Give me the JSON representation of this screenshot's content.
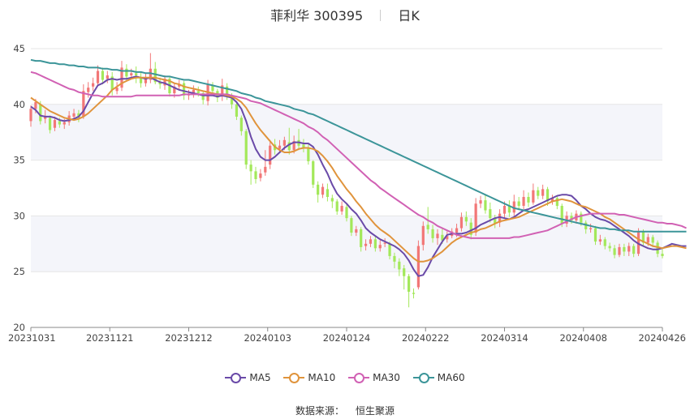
{
  "header": {
    "title": "菲利华 300395",
    "period": "日K"
  },
  "footer": {
    "source_label": "数据来源：",
    "source_name": "恒生聚源"
  },
  "colors": {
    "up": "#f27777",
    "down": "#a3e85a",
    "MA5": "#6a4aa8",
    "MA10": "#e0943c",
    "MA30": "#d161b4",
    "MA60": "#3c9599",
    "band": "#f4f5fa",
    "grid": "#e6e6e6"
  },
  "chart_data": {
    "type": "candlestick",
    "title": "菲利华 300395",
    "ylim": [
      20,
      45
    ],
    "yticks": [
      "20",
      "25",
      "30",
      "35",
      "40",
      "45"
    ],
    "xticks": [
      "20231031",
      "20231121",
      "20231212",
      "20240103",
      "20240124",
      "20240222",
      "20240314",
      "20240408",
      "20240426"
    ],
    "legend": [
      "MA5",
      "MA10",
      "MA30",
      "MA60"
    ],
    "legend_position": "bottom",
    "candles": [
      [
        38.5,
        39.6,
        39.9,
        38.0
      ],
      [
        39.6,
        40.2,
        40.5,
        39.2
      ],
      [
        40.0,
        38.5,
        40.3,
        38.2
      ],
      [
        38.7,
        38.9,
        39.5,
        38.3
      ],
      [
        38.8,
        37.7,
        39.0,
        37.4
      ],
      [
        37.9,
        38.6,
        38.9,
        37.6
      ],
      [
        38.5,
        38.2,
        38.8,
        37.9
      ],
      [
        38.2,
        38.4,
        38.7,
        37.8
      ],
      [
        38.4,
        39.0,
        39.4,
        38.1
      ],
      [
        38.9,
        39.2,
        39.6,
        38.6
      ],
      [
        39.2,
        38.8,
        39.5,
        38.4
      ],
      [
        38.9,
        41.2,
        41.8,
        38.7
      ],
      [
        41.1,
        41.5,
        42.0,
        40.6
      ],
      [
        41.6,
        41.9,
        42.4,
        41.2
      ],
      [
        41.9,
        43.0,
        43.5,
        41.6
      ],
      [
        43.0,
        42.2,
        43.3,
        41.8
      ],
      [
        42.3,
        42.6,
        43.0,
        41.9
      ],
      [
        42.5,
        41.3,
        42.9,
        40.8
      ],
      [
        41.2,
        41.5,
        42.0,
        40.9
      ],
      [
        41.5,
        43.3,
        43.9,
        41.2
      ],
      [
        43.2,
        42.5,
        43.6,
        42.1
      ],
      [
        42.6,
        42.8,
        43.2,
        42.3
      ],
      [
        42.8,
        42.6,
        43.4,
        41.9
      ],
      [
        42.4,
        41.9,
        42.9,
        41.5
      ],
      [
        41.9,
        42.3,
        42.8,
        41.6
      ],
      [
        42.2,
        43.2,
        44.6,
        41.9
      ],
      [
        43.2,
        42.0,
        43.8,
        41.8
      ],
      [
        42.0,
        41.8,
        42.4,
        41.4
      ],
      [
        41.7,
        42.3,
        42.6,
        41.3
      ],
      [
        42.3,
        41.0,
        42.5,
        40.7
      ],
      [
        41.0,
        41.6,
        41.9,
        40.6
      ],
      [
        41.6,
        41.8,
        42.2,
        41.3
      ],
      [
        41.9,
        40.8,
        42.1,
        40.4
      ],
      [
        40.8,
        40.9,
        41.3,
        40.4
      ],
      [
        40.9,
        41.3,
        41.7,
        40.6
      ],
      [
        41.2,
        41.0,
        41.6,
        40.7
      ],
      [
        41.0,
        40.4,
        41.2,
        40.0
      ],
      [
        40.3,
        41.8,
        42.2,
        39.9
      ],
      [
        41.7,
        41.2,
        42.0,
        40.8
      ],
      [
        41.2,
        40.6,
        41.4,
        40.2
      ],
      [
        40.7,
        41.7,
        42.3,
        40.3
      ],
      [
        41.6,
        40.8,
        41.9,
        40.4
      ],
      [
        40.8,
        40.0,
        41.0,
        39.6
      ],
      [
        40.0,
        38.9,
        40.2,
        38.6
      ],
      [
        38.8,
        37.6,
        39.0,
        37.2
      ],
      [
        37.6,
        34.6,
        37.8,
        34.2
      ],
      [
        34.6,
        34.0,
        35.0,
        32.8
      ],
      [
        34.0,
        33.3,
        34.4,
        32.9
      ],
      [
        33.4,
        33.8,
        34.2,
        33.1
      ],
      [
        33.9,
        34.4,
        35.9,
        33.6
      ],
      [
        34.6,
        36.3,
        36.8,
        34.2
      ],
      [
        36.4,
        35.9,
        36.9,
        35.5
      ],
      [
        36.0,
        36.3,
        36.8,
        35.7
      ],
      [
        36.3,
        36.8,
        37.1,
        35.9
      ],
      [
        36.6,
        35.9,
        37.9,
        35.5
      ],
      [
        35.9,
        36.7,
        37.2,
        35.6
      ],
      [
        36.8,
        36.3,
        37.8,
        35.9
      ],
      [
        36.4,
        36.1,
        36.9,
        35.7
      ],
      [
        36.1,
        34.9,
        36.4,
        34.6
      ],
      [
        34.9,
        32.8,
        35.0,
        32.5
      ],
      [
        32.8,
        31.9,
        33.1,
        31.2
      ],
      [
        31.9,
        32.6,
        32.9,
        31.6
      ],
      [
        32.4,
        31.7,
        32.9,
        31.3
      ],
      [
        31.6,
        31.3,
        31.9,
        30.7
      ],
      [
        31.3,
        30.4,
        31.5,
        30.1
      ],
      [
        30.4,
        30.9,
        31.3,
        30.1
      ],
      [
        30.8,
        29.8,
        31.0,
        29.5
      ],
      [
        29.8,
        28.5,
        30.0,
        28.2
      ],
      [
        28.5,
        28.8,
        29.1,
        28.2
      ],
      [
        28.8,
        27.2,
        29.0,
        26.8
      ],
      [
        27.3,
        27.5,
        27.9,
        26.9
      ],
      [
        27.5,
        27.9,
        28.2,
        27.2
      ],
      [
        27.9,
        27.1,
        28.2,
        26.8
      ],
      [
        27.1,
        27.4,
        27.8,
        26.8
      ],
      [
        27.5,
        27.6,
        28.0,
        27.2
      ],
      [
        27.5,
        26.4,
        27.7,
        26.1
      ],
      [
        26.4,
        25.9,
        26.7,
        25.3
      ],
      [
        25.9,
        25.2,
        26.2,
        24.6
      ],
      [
        25.3,
        24.6,
        25.6,
        23.4
      ],
      [
        24.6,
        23.2,
        24.8,
        21.8
      ],
      [
        23.1,
        23.0,
        23.5,
        22.6
      ],
      [
        23.6,
        27.3,
        27.8,
        23.4
      ],
      [
        27.4,
        29.1,
        29.5,
        26.9
      ],
      [
        29.2,
        28.8,
        30.8,
        28.4
      ],
      [
        28.8,
        28.0,
        29.2,
        27.6
      ],
      [
        28.0,
        28.4,
        28.8,
        27.4
      ],
      [
        28.3,
        27.8,
        28.9,
        27.5
      ],
      [
        27.9,
        28.2,
        28.6,
        27.6
      ],
      [
        28.2,
        28.6,
        28.9,
        28.0
      ],
      [
        28.5,
        28.9,
        29.3,
        28.1
      ],
      [
        28.9,
        29.9,
        30.3,
        28.6
      ],
      [
        29.9,
        29.5,
        30.4,
        29.1
      ],
      [
        29.4,
        28.3,
        29.8,
        27.9
      ],
      [
        28.5,
        31.1,
        31.6,
        28.2
      ],
      [
        31.1,
        31.4,
        31.8,
        30.7
      ],
      [
        31.4,
        30.5,
        31.9,
        30.2
      ],
      [
        30.6,
        29.8,
        31.2,
        29.4
      ],
      [
        29.8,
        29.3,
        30.1,
        28.9
      ],
      [
        29.4,
        30.2,
        30.6,
        29.0
      ],
      [
        30.2,
        30.9,
        31.3,
        29.8
      ],
      [
        30.9,
        30.3,
        31.4,
        29.9
      ],
      [
        30.3,
        31.3,
        31.9,
        30.0
      ],
      [
        31.3,
        30.9,
        31.7,
        30.5
      ],
      [
        30.9,
        31.7,
        32.3,
        30.6
      ],
      [
        31.7,
        31.2,
        32.1,
        30.8
      ],
      [
        31.2,
        32.3,
        32.9,
        31.0
      ],
      [
        32.3,
        31.8,
        32.6,
        31.5
      ],
      [
        31.8,
        32.4,
        32.8,
        31.5
      ],
      [
        32.4,
        31.3,
        32.6,
        30.9
      ],
      [
        31.3,
        31.6,
        31.9,
        31.0
      ],
      [
        31.6,
        30.9,
        31.8,
        30.6
      ],
      [
        30.9,
        29.3,
        31.1,
        29.0
      ],
      [
        29.3,
        30.0,
        30.4,
        29.0
      ],
      [
        30.0,
        29.6,
        30.3,
        29.3
      ],
      [
        29.6,
        30.2,
        30.5,
        29.3
      ],
      [
        30.2,
        29.4,
        30.4,
        29.1
      ],
      [
        29.4,
        28.8,
        29.6,
        28.4
      ],
      [
        28.8,
        28.9,
        29.3,
        28.5
      ],
      [
        28.9,
        27.7,
        29.1,
        27.4
      ],
      [
        27.7,
        27.9,
        28.3,
        27.4
      ],
      [
        27.9,
        27.3,
        28.1,
        27.0
      ],
      [
        27.3,
        27.1,
        27.6,
        26.8
      ],
      [
        27.1,
        26.5,
        27.4,
        26.2
      ],
      [
        26.5,
        27.2,
        27.5,
        26.3
      ],
      [
        27.2,
        26.8,
        27.5,
        26.4
      ],
      [
        26.8,
        27.3,
        27.6,
        26.4
      ],
      [
        27.3,
        26.6,
        27.5,
        26.3
      ],
      [
        26.6,
        28.6,
        28.9,
        26.4
      ],
      [
        28.6,
        27.6,
        28.8,
        27.3
      ],
      [
        27.6,
        28.1,
        28.4,
        27.3
      ],
      [
        28.1,
        27.6,
        28.3,
        27.2
      ],
      [
        27.6,
        26.6,
        27.8,
        26.3
      ],
      [
        26.6,
        26.4,
        27.0,
        26.2
      ]
    ],
    "series": [
      {
        "name": "MA5",
        "values": [
          39.8,
          39.5,
          39.0,
          38.9,
          38.9,
          38.8,
          38.6,
          38.5,
          38.6,
          38.7,
          38.9,
          39.4,
          40.2,
          41.0,
          41.7,
          41.9,
          42.2,
          42.3,
          42.2,
          42.3,
          42.3,
          42.4,
          42.5,
          42.4,
          42.3,
          42.4,
          42.2,
          42.0,
          41.9,
          41.7,
          41.5,
          41.3,
          41.2,
          41.1,
          41.0,
          40.9,
          40.8,
          40.8,
          40.8,
          40.7,
          40.8,
          40.7,
          40.6,
          40.2,
          39.6,
          38.5,
          37.1,
          36.0,
          35.3,
          35.0,
          35.0,
          35.3,
          35.7,
          36.1,
          36.4,
          36.6,
          36.6,
          36.5,
          36.5,
          36.2,
          35.5,
          34.6,
          33.8,
          32.8,
          32.0,
          31.5,
          31.1,
          30.6,
          30.2,
          29.6,
          28.9,
          28.5,
          28.2,
          27.9,
          27.7,
          27.5,
          27.3,
          27.0,
          26.6,
          26.0,
          25.2,
          24.6,
          24.7,
          25.4,
          26.3,
          27.0,
          27.7,
          28.3,
          28.4,
          28.4,
          28.4,
          28.5,
          28.7,
          28.9,
          29.2,
          29.4,
          29.6,
          29.8,
          29.9,
          29.8,
          29.7,
          29.9,
          30.2,
          30.5,
          30.6,
          30.8,
          31.0,
          31.2,
          31.4,
          31.6,
          31.8,
          31.9,
          31.9,
          31.8,
          31.4,
          30.9,
          30.6,
          30.2,
          29.9,
          29.7,
          29.6,
          29.4,
          29.1,
          28.8,
          28.5,
          28.2,
          27.8,
          27.5,
          27.3,
          27.1,
          27.0,
          27.0,
          27.1,
          27.3,
          27.5,
          27.4,
          27.3,
          27.3
        ]
      },
      {
        "name": "MA10",
        "values": [
          40.6,
          40.3,
          40.0,
          39.7,
          39.4,
          39.2,
          39.0,
          38.8,
          38.7,
          38.6,
          38.7,
          38.9,
          39.2,
          39.6,
          40.0,
          40.4,
          40.8,
          41.3,
          41.6,
          41.9,
          42.1,
          42.3,
          42.4,
          42.4,
          42.4,
          42.4,
          42.4,
          42.3,
          42.2,
          42.1,
          41.9,
          41.8,
          41.6,
          41.5,
          41.4,
          41.3,
          41.2,
          41.1,
          41.0,
          40.9,
          40.9,
          40.8,
          40.7,
          40.5,
          40.2,
          39.7,
          39.0,
          38.3,
          37.7,
          37.2,
          36.7,
          36.2,
          35.9,
          35.7,
          35.7,
          35.8,
          36.0,
          36.1,
          36.1,
          36.0,
          35.8,
          35.4,
          34.9,
          34.3,
          33.6,
          33.0,
          32.4,
          31.9,
          31.3,
          30.8,
          30.2,
          29.7,
          29.2,
          28.8,
          28.5,
          28.2,
          27.8,
          27.4,
          27.0,
          26.6,
          26.2,
          25.9,
          25.9,
          26.0,
          26.2,
          26.5,
          26.8,
          27.2,
          27.6,
          27.9,
          28.1,
          28.3,
          28.5,
          28.6,
          28.8,
          28.9,
          29.1,
          29.3,
          29.5,
          29.6,
          29.7,
          29.8,
          29.9,
          30.1,
          30.3,
          30.5,
          30.7,
          30.9,
          31.1,
          31.3,
          31.4,
          31.5,
          31.4,
          31.3,
          31.1,
          30.9,
          30.8,
          30.6,
          30.4,
          30.2,
          29.9,
          29.7,
          29.4,
          29.1,
          28.8,
          28.5,
          28.2,
          27.9,
          27.7,
          27.5,
          27.3,
          27.2,
          27.1,
          27.2,
          27.3,
          27.3,
          27.2,
          27.1
        ]
      },
      {
        "name": "MA30",
        "values": [
          42.9,
          42.8,
          42.6,
          42.4,
          42.2,
          42.0,
          41.8,
          41.6,
          41.4,
          41.3,
          41.1,
          41.0,
          40.9,
          40.8,
          40.8,
          40.7,
          40.7,
          40.7,
          40.7,
          40.7,
          40.7,
          40.7,
          40.8,
          40.8,
          40.8,
          40.8,
          40.8,
          40.8,
          40.8,
          40.8,
          40.8,
          40.8,
          40.9,
          40.9,
          40.9,
          40.9,
          40.9,
          40.9,
          40.9,
          40.9,
          40.9,
          40.9,
          40.8,
          40.7,
          40.6,
          40.5,
          40.3,
          40.2,
          40.1,
          39.9,
          39.7,
          39.5,
          39.3,
          39.1,
          38.9,
          38.7,
          38.5,
          38.3,
          38.0,
          37.8,
          37.5,
          37.1,
          36.8,
          36.4,
          36.0,
          35.6,
          35.2,
          34.8,
          34.4,
          34.0,
          33.6,
          33.2,
          32.9,
          32.5,
          32.2,
          31.9,
          31.6,
          31.3,
          31.0,
          30.7,
          30.4,
          30.1,
          29.9,
          29.6,
          29.4,
          29.1,
          28.9,
          28.7,
          28.5,
          28.3,
          28.2,
          28.1,
          28.0,
          28.0,
          28.0,
          28.0,
          28.0,
          28.0,
          28.0,
          28.0,
          28.0,
          28.1,
          28.1,
          28.2,
          28.3,
          28.4,
          28.5,
          28.6,
          28.7,
          28.9,
          29.1,
          29.3,
          29.5,
          29.7,
          29.9,
          30.0,
          30.1,
          30.2,
          30.2,
          30.2,
          30.2,
          30.2,
          30.2,
          30.1,
          30.1,
          30.0,
          29.9,
          29.8,
          29.7,
          29.6,
          29.5,
          29.4,
          29.4,
          29.3,
          29.3,
          29.2,
          29.1,
          28.9
        ]
      },
      {
        "name": "MA60",
        "values": [
          44.0,
          43.9,
          43.9,
          43.8,
          43.7,
          43.7,
          43.6,
          43.6,
          43.5,
          43.5,
          43.4,
          43.4,
          43.3,
          43.3,
          43.3,
          43.2,
          43.2,
          43.1,
          43.1,
          43.0,
          43.0,
          43.0,
          42.9,
          42.9,
          42.8,
          42.8,
          42.7,
          42.6,
          42.5,
          42.5,
          42.4,
          42.3,
          42.2,
          42.2,
          42.1,
          42.0,
          41.9,
          41.8,
          41.7,
          41.6,
          41.5,
          41.4,
          41.3,
          41.2,
          41.0,
          40.9,
          40.8,
          40.6,
          40.5,
          40.3,
          40.2,
          40.1,
          40.0,
          39.9,
          39.8,
          39.6,
          39.5,
          39.4,
          39.2,
          39.1,
          38.9,
          38.7,
          38.5,
          38.3,
          38.1,
          37.9,
          37.7,
          37.5,
          37.3,
          37.1,
          36.9,
          36.7,
          36.5,
          36.3,
          36.1,
          35.9,
          35.7,
          35.5,
          35.3,
          35.1,
          34.9,
          34.7,
          34.5,
          34.3,
          34.1,
          33.9,
          33.7,
          33.5,
          33.3,
          33.1,
          32.9,
          32.7,
          32.5,
          32.3,
          32.1,
          31.9,
          31.7,
          31.5,
          31.3,
          31.1,
          30.9,
          30.7,
          30.6,
          30.5,
          30.4,
          30.3,
          30.2,
          30.1,
          30.0,
          29.9,
          29.8,
          29.7,
          29.6,
          29.5,
          29.4,
          29.3,
          29.2,
          29.1,
          29.0,
          28.9,
          28.9,
          28.8,
          28.8,
          28.7,
          28.7,
          28.7,
          28.6,
          28.6,
          28.6,
          28.6,
          28.6,
          28.6,
          28.6,
          28.6,
          28.6,
          28.6,
          28.6,
          28.6
        ]
      }
    ]
  }
}
